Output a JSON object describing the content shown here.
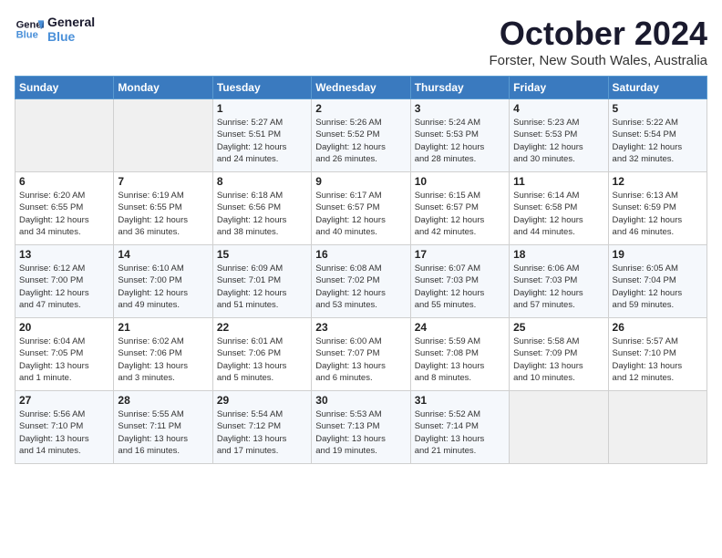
{
  "header": {
    "logo_line1": "General",
    "logo_line2": "Blue",
    "month": "October 2024",
    "location": "Forster, New South Wales, Australia"
  },
  "days_of_week": [
    "Sunday",
    "Monday",
    "Tuesday",
    "Wednesday",
    "Thursday",
    "Friday",
    "Saturday"
  ],
  "weeks": [
    [
      {
        "num": "",
        "detail": ""
      },
      {
        "num": "",
        "detail": ""
      },
      {
        "num": "1",
        "detail": "Sunrise: 5:27 AM\nSunset: 5:51 PM\nDaylight: 12 hours\nand 24 minutes."
      },
      {
        "num": "2",
        "detail": "Sunrise: 5:26 AM\nSunset: 5:52 PM\nDaylight: 12 hours\nand 26 minutes."
      },
      {
        "num": "3",
        "detail": "Sunrise: 5:24 AM\nSunset: 5:53 PM\nDaylight: 12 hours\nand 28 minutes."
      },
      {
        "num": "4",
        "detail": "Sunrise: 5:23 AM\nSunset: 5:53 PM\nDaylight: 12 hours\nand 30 minutes."
      },
      {
        "num": "5",
        "detail": "Sunrise: 5:22 AM\nSunset: 5:54 PM\nDaylight: 12 hours\nand 32 minutes."
      }
    ],
    [
      {
        "num": "6",
        "detail": "Sunrise: 6:20 AM\nSunset: 6:55 PM\nDaylight: 12 hours\nand 34 minutes."
      },
      {
        "num": "7",
        "detail": "Sunrise: 6:19 AM\nSunset: 6:55 PM\nDaylight: 12 hours\nand 36 minutes."
      },
      {
        "num": "8",
        "detail": "Sunrise: 6:18 AM\nSunset: 6:56 PM\nDaylight: 12 hours\nand 38 minutes."
      },
      {
        "num": "9",
        "detail": "Sunrise: 6:17 AM\nSunset: 6:57 PM\nDaylight: 12 hours\nand 40 minutes."
      },
      {
        "num": "10",
        "detail": "Sunrise: 6:15 AM\nSunset: 6:57 PM\nDaylight: 12 hours\nand 42 minutes."
      },
      {
        "num": "11",
        "detail": "Sunrise: 6:14 AM\nSunset: 6:58 PM\nDaylight: 12 hours\nand 44 minutes."
      },
      {
        "num": "12",
        "detail": "Sunrise: 6:13 AM\nSunset: 6:59 PM\nDaylight: 12 hours\nand 46 minutes."
      }
    ],
    [
      {
        "num": "13",
        "detail": "Sunrise: 6:12 AM\nSunset: 7:00 PM\nDaylight: 12 hours\nand 47 minutes."
      },
      {
        "num": "14",
        "detail": "Sunrise: 6:10 AM\nSunset: 7:00 PM\nDaylight: 12 hours\nand 49 minutes."
      },
      {
        "num": "15",
        "detail": "Sunrise: 6:09 AM\nSunset: 7:01 PM\nDaylight: 12 hours\nand 51 minutes."
      },
      {
        "num": "16",
        "detail": "Sunrise: 6:08 AM\nSunset: 7:02 PM\nDaylight: 12 hours\nand 53 minutes."
      },
      {
        "num": "17",
        "detail": "Sunrise: 6:07 AM\nSunset: 7:03 PM\nDaylight: 12 hours\nand 55 minutes."
      },
      {
        "num": "18",
        "detail": "Sunrise: 6:06 AM\nSunset: 7:03 PM\nDaylight: 12 hours\nand 57 minutes."
      },
      {
        "num": "19",
        "detail": "Sunrise: 6:05 AM\nSunset: 7:04 PM\nDaylight: 12 hours\nand 59 minutes."
      }
    ],
    [
      {
        "num": "20",
        "detail": "Sunrise: 6:04 AM\nSunset: 7:05 PM\nDaylight: 13 hours\nand 1 minute."
      },
      {
        "num": "21",
        "detail": "Sunrise: 6:02 AM\nSunset: 7:06 PM\nDaylight: 13 hours\nand 3 minutes."
      },
      {
        "num": "22",
        "detail": "Sunrise: 6:01 AM\nSunset: 7:06 PM\nDaylight: 13 hours\nand 5 minutes."
      },
      {
        "num": "23",
        "detail": "Sunrise: 6:00 AM\nSunset: 7:07 PM\nDaylight: 13 hours\nand 6 minutes."
      },
      {
        "num": "24",
        "detail": "Sunrise: 5:59 AM\nSunset: 7:08 PM\nDaylight: 13 hours\nand 8 minutes."
      },
      {
        "num": "25",
        "detail": "Sunrise: 5:58 AM\nSunset: 7:09 PM\nDaylight: 13 hours\nand 10 minutes."
      },
      {
        "num": "26",
        "detail": "Sunrise: 5:57 AM\nSunset: 7:10 PM\nDaylight: 13 hours\nand 12 minutes."
      }
    ],
    [
      {
        "num": "27",
        "detail": "Sunrise: 5:56 AM\nSunset: 7:10 PM\nDaylight: 13 hours\nand 14 minutes."
      },
      {
        "num": "28",
        "detail": "Sunrise: 5:55 AM\nSunset: 7:11 PM\nDaylight: 13 hours\nand 16 minutes."
      },
      {
        "num": "29",
        "detail": "Sunrise: 5:54 AM\nSunset: 7:12 PM\nDaylight: 13 hours\nand 17 minutes."
      },
      {
        "num": "30",
        "detail": "Sunrise: 5:53 AM\nSunset: 7:13 PM\nDaylight: 13 hours\nand 19 minutes."
      },
      {
        "num": "31",
        "detail": "Sunrise: 5:52 AM\nSunset: 7:14 PM\nDaylight: 13 hours\nand 21 minutes."
      },
      {
        "num": "",
        "detail": ""
      },
      {
        "num": "",
        "detail": ""
      }
    ]
  ]
}
